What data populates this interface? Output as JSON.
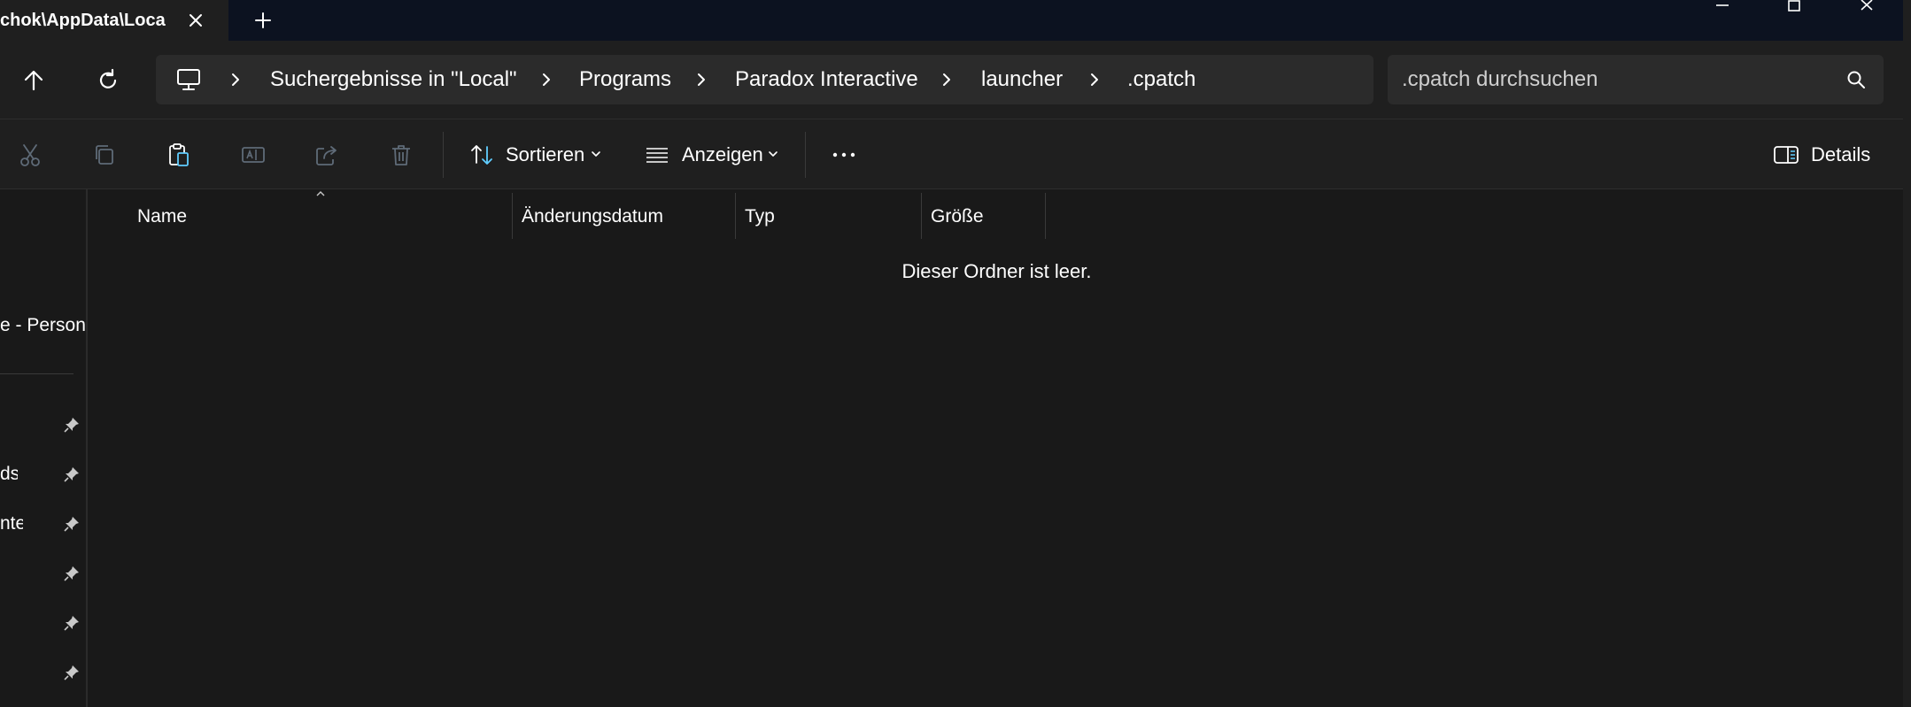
{
  "window": {
    "tab_title": "chok\\AppData\\Loca"
  },
  "address": {
    "breadcrumb": [
      "Suchergebnisse in \"Local\"",
      "Programs",
      "Paradox Interactive",
      "launcher",
      ".cpatch"
    ]
  },
  "search": {
    "placeholder": ".cpatch durchsuchen"
  },
  "toolbar": {
    "sort_label": "Sortieren",
    "view_label": "Anzeigen",
    "details_label": "Details"
  },
  "sidebar": {
    "items": [
      {
        "label": "e - Persona"
      },
      {
        "label": ""
      },
      {
        "label": "ds"
      },
      {
        "label": "nte"
      },
      {
        "label": ""
      },
      {
        "label": ""
      },
      {
        "label": ""
      }
    ]
  },
  "file_list": {
    "columns": [
      "Name",
      "Änderungsdatum",
      "Typ",
      "Größe"
    ],
    "empty_message": "Dieser Ordner ist leer."
  },
  "colors": {
    "background": "#191919",
    "chrome": "#1f1f1f",
    "titlebar": "#0c1220",
    "field": "#2b2b2b",
    "accent": "#60cdff"
  },
  "icons": [
    "close-icon",
    "plus-icon",
    "minimize-icon",
    "maximize-icon",
    "window-close-icon",
    "arrow-up-icon",
    "refresh-icon",
    "computer-icon",
    "chevron-right-icon",
    "search-icon",
    "cut-icon",
    "copy-icon",
    "paste-icon",
    "rename-icon",
    "share-icon",
    "delete-icon",
    "sort-icon",
    "view-icon",
    "more-icon",
    "details-pane-icon",
    "pin-icon"
  ]
}
